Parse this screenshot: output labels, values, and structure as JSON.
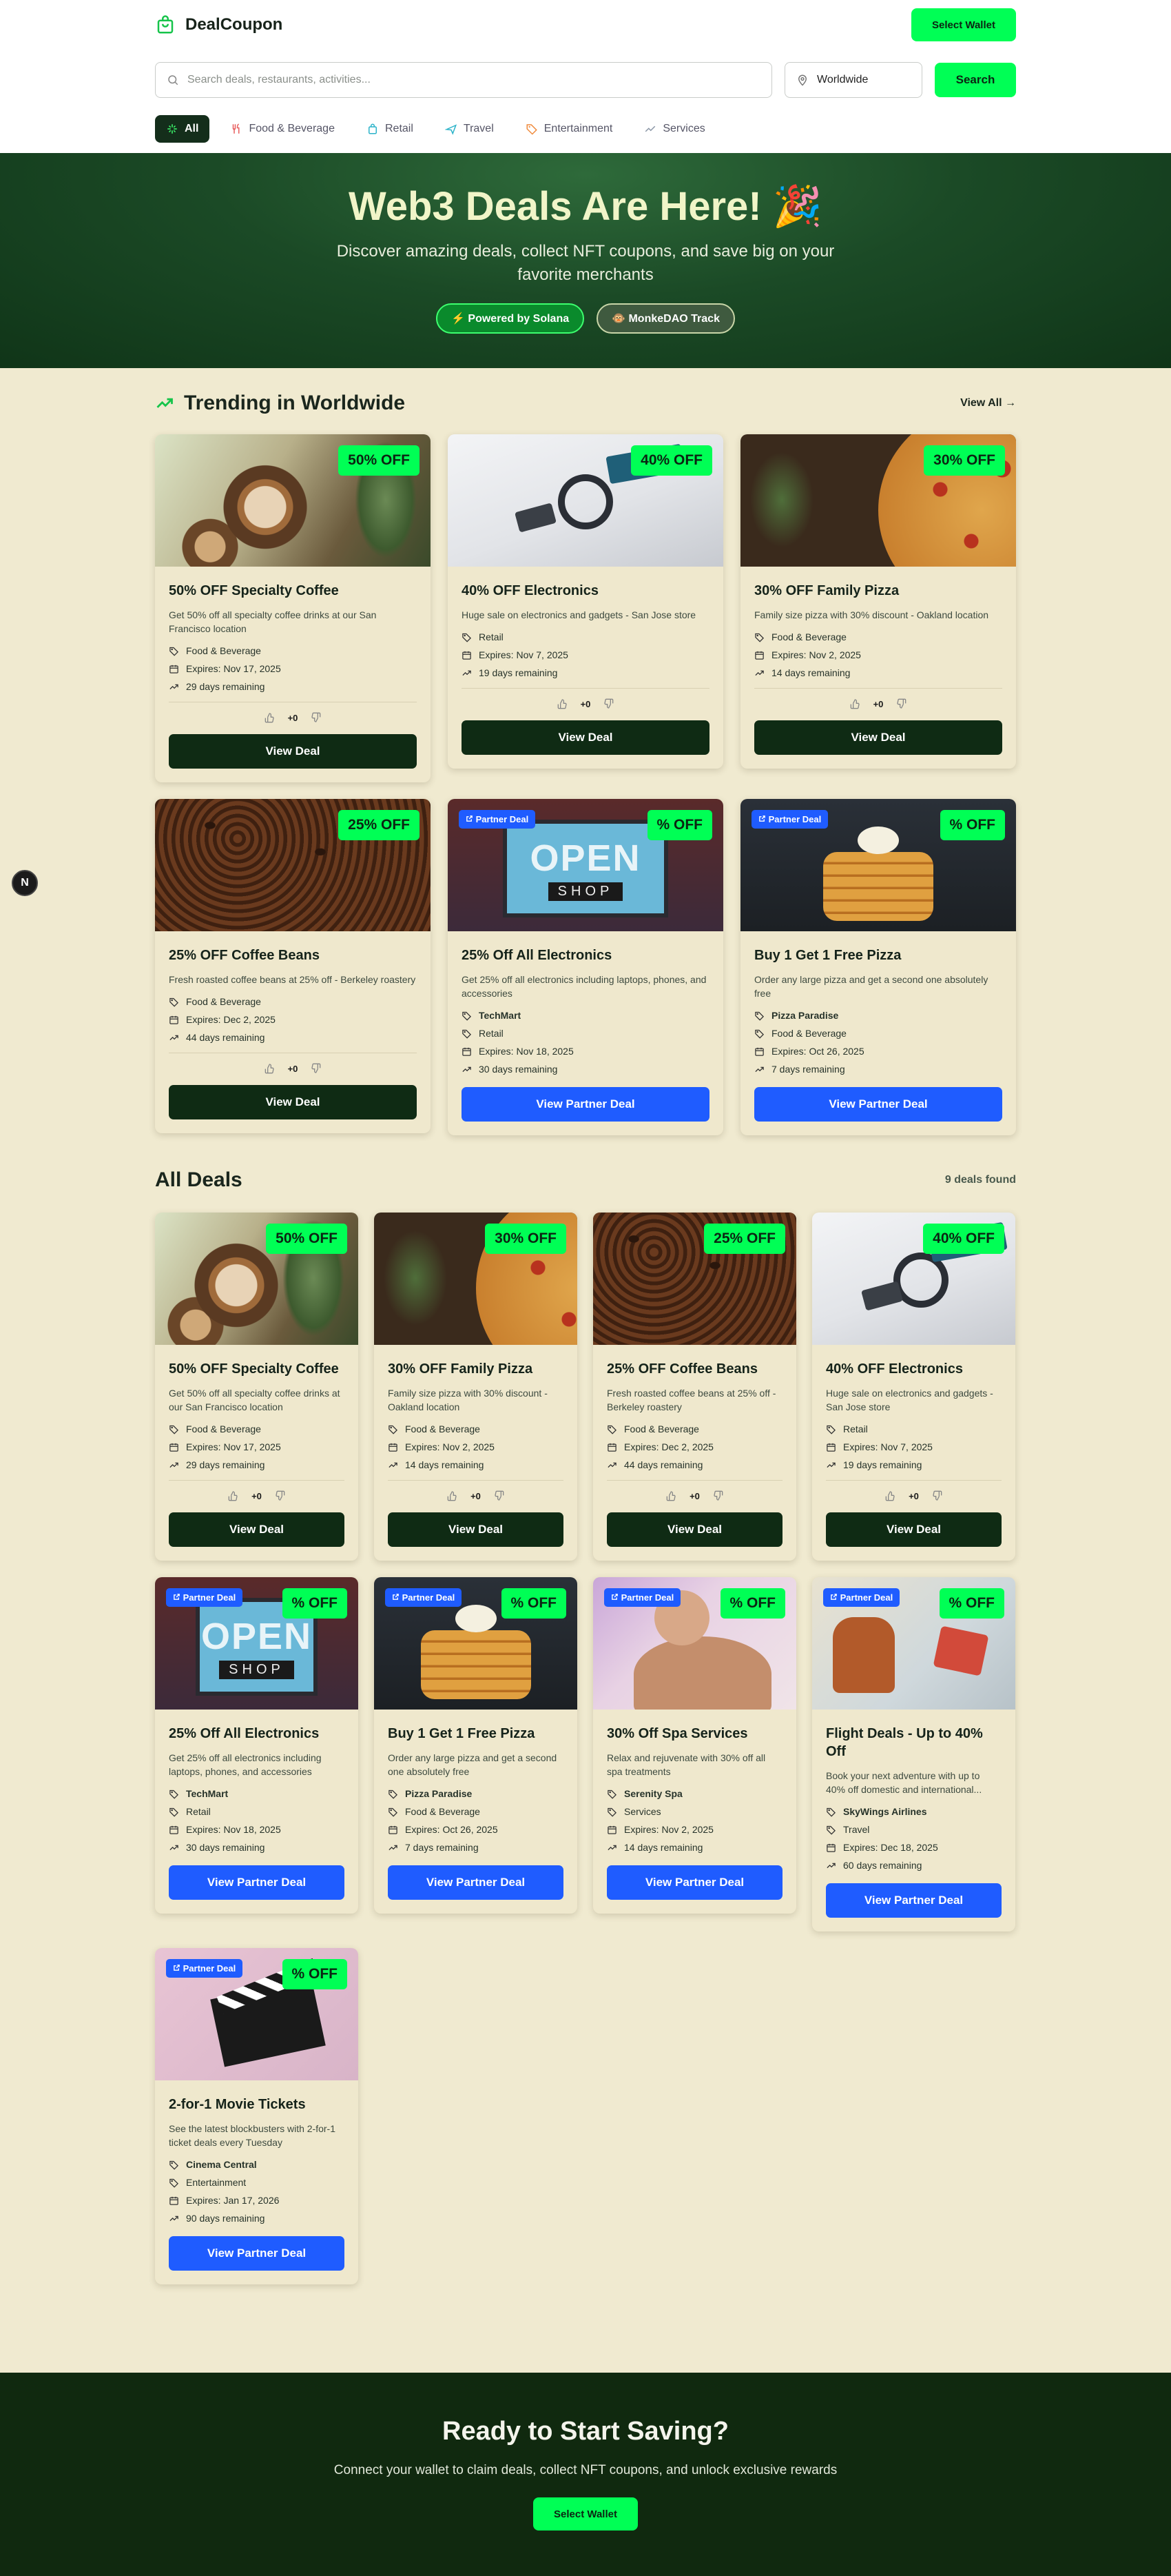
{
  "header": {
    "brand": "DealCoupon",
    "select_wallet": "Select Wallet",
    "search_placeholder": "Search deals, restaurants, activities...",
    "location": "Worldwide",
    "search_button": "Search",
    "categories": [
      {
        "label": "All",
        "icon": "sparkle-icon"
      },
      {
        "label": "Food & Beverage",
        "icon": "utensils-icon"
      },
      {
        "label": "Retail",
        "icon": "shopping-bag-icon"
      },
      {
        "label": "Travel",
        "icon": "plane-icon"
      },
      {
        "label": "Entertainment",
        "icon": "tag-icon"
      },
      {
        "label": "Services",
        "icon": "trending-icon"
      }
    ]
  },
  "hero": {
    "title": "Web3 Deals Are Here! 🎉",
    "subtitle": "Discover amazing deals, collect NFT coupons, and save big on your favorite merchants",
    "pill1": "⚡ Powered by Solana",
    "pill2": "🐵 MonkeDAO Track"
  },
  "trending": {
    "title": "Trending in Worldwide",
    "view_all": "View All →",
    "deals": [
      {
        "badge": "50% OFF",
        "title": "50% OFF Specialty Coffee",
        "desc": "Get 50% off all specialty coffee drinks at our San Francisco location",
        "category": "Food & Beverage",
        "expires": "Expires: Nov 17, 2025",
        "remaining": "29 days remaining",
        "votes": "+0",
        "button": "View Deal"
      },
      {
        "badge": "40% OFF",
        "title": "40% OFF Electronics",
        "desc": "Huge sale on electronics and gadgets - San Jose store",
        "category": "Retail",
        "expires": "Expires: Nov 7, 2025",
        "remaining": "19 days remaining",
        "votes": "+0",
        "button": "View Deal"
      },
      {
        "badge": "30% OFF",
        "title": "30% OFF Family Pizza",
        "desc": "Family size pizza with 30% discount - Oakland location",
        "category": "Food & Beverage",
        "expires": "Expires: Nov 2, 2025",
        "remaining": "14 days remaining",
        "votes": "+0",
        "button": "View Deal"
      },
      {
        "badge": "25% OFF",
        "title": "25% OFF Coffee Beans",
        "desc": "Fresh roasted coffee beans at 25% off - Berkeley roastery",
        "category": "Food & Beverage",
        "expires": "Expires: Dec 2, 2025",
        "remaining": "44 days remaining",
        "votes": "+0",
        "button": "View Deal"
      },
      {
        "partner": "Partner Deal",
        "badge": "% OFF",
        "title": "25% Off All Electronics",
        "desc": "Get 25% off all electronics including laptops, phones, and accessories",
        "merchant": "TechMart",
        "category": "Retail",
        "expires": "Expires: Nov 18, 2025",
        "remaining": "30 days remaining",
        "button": "View Partner Deal"
      },
      {
        "partner": "Partner Deal",
        "badge": "% OFF",
        "title": "Buy 1 Get 1 Free Pizza",
        "desc": "Order any large pizza and get a second one absolutely free",
        "merchant": "Pizza Paradise",
        "category": "Food & Beverage",
        "expires": "Expires: Oct 26, 2025",
        "remaining": "7 days remaining",
        "button": "View Partner Deal"
      }
    ]
  },
  "all": {
    "title": "All Deals",
    "count": "9 deals found",
    "deals": [
      {
        "badge": "50% OFF",
        "title": "50% OFF Specialty Coffee",
        "desc": "Get 50% off all specialty coffee drinks at our San Francisco location",
        "category": "Food & Beverage",
        "expires": "Expires: Nov 17, 2025",
        "remaining": "29 days remaining",
        "votes": "+0",
        "button": "View Deal"
      },
      {
        "badge": "30% OFF",
        "title": "30% OFF Family Pizza",
        "desc": "Family size pizza with 30% discount - Oakland location",
        "category": "Food & Beverage",
        "expires": "Expires: Nov 2, 2025",
        "remaining": "14 days remaining",
        "votes": "+0",
        "button": "View Deal"
      },
      {
        "badge": "25% OFF",
        "title": "25% OFF Coffee Beans",
        "desc": "Fresh roasted coffee beans at 25% off - Berkeley roastery",
        "category": "Food & Beverage",
        "expires": "Expires: Dec 2, 2025",
        "remaining": "44 days remaining",
        "votes": "+0",
        "button": "View Deal"
      },
      {
        "badge": "40% OFF",
        "title": "40% OFF Electronics",
        "desc": "Huge sale on electronics and gadgets - San Jose store",
        "category": "Retail",
        "expires": "Expires: Nov 7, 2025",
        "remaining": "19 days remaining",
        "votes": "+0",
        "button": "View Deal"
      },
      {
        "partner": "Partner Deal",
        "badge": "% OFF",
        "title": "25% Off All Electronics",
        "desc": "Get 25% off all electronics including laptops, phones, and accessories",
        "merchant": "TechMart",
        "category": "Retail",
        "expires": "Expires: Nov 18, 2025",
        "remaining": "30 days remaining",
        "button": "View Partner Deal"
      },
      {
        "partner": "Partner Deal",
        "badge": "% OFF",
        "title": "Buy 1 Get 1 Free Pizza",
        "desc": "Order any large pizza and get a second one absolutely free",
        "merchant": "Pizza Paradise",
        "category": "Food & Beverage",
        "expires": "Expires: Oct 26, 2025",
        "remaining": "7 days remaining",
        "button": "View Partner Deal"
      },
      {
        "partner": "Partner Deal",
        "badge": "% OFF",
        "title": "30% Off Spa Services",
        "desc": "Relax and rejuvenate with 30% off all spa treatments",
        "merchant": "Serenity Spa",
        "category": "Services",
        "expires": "Expires: Nov 2, 2025",
        "remaining": "14 days remaining",
        "button": "View Partner Deal"
      },
      {
        "partner": "Partner Deal",
        "badge": "% OFF",
        "title": "Flight Deals - Up to 40% Off",
        "desc": "Book your next adventure with up to 40% off domestic and international...",
        "merchant": "SkyWings Airlines",
        "category": "Travel",
        "expires": "Expires: Dec 18, 2025",
        "remaining": "60 days remaining",
        "button": "View Partner Deal"
      },
      {
        "partner": "Partner Deal",
        "badge": "% OFF",
        "title": "2-for-1 Movie Tickets",
        "desc": "See the latest blockbusters with 2-for-1 ticket deals every Tuesday",
        "merchant": "Cinema Central",
        "category": "Entertainment",
        "expires": "Expires: Jan 17, 2026",
        "remaining": "90 days remaining",
        "button": "View Partner Deal"
      }
    ]
  },
  "cta": {
    "title": "Ready to Start Saving?",
    "text": "Connect your wallet to claim deals, collect NFT coupons, and unlock exclusive rewards",
    "button": "Select Wallet"
  },
  "floating": "N",
  "colors": {
    "accent": "#00ff55",
    "dark": "#0f2b14",
    "partner": "#1f5cff",
    "bg": "#f0ead0"
  }
}
